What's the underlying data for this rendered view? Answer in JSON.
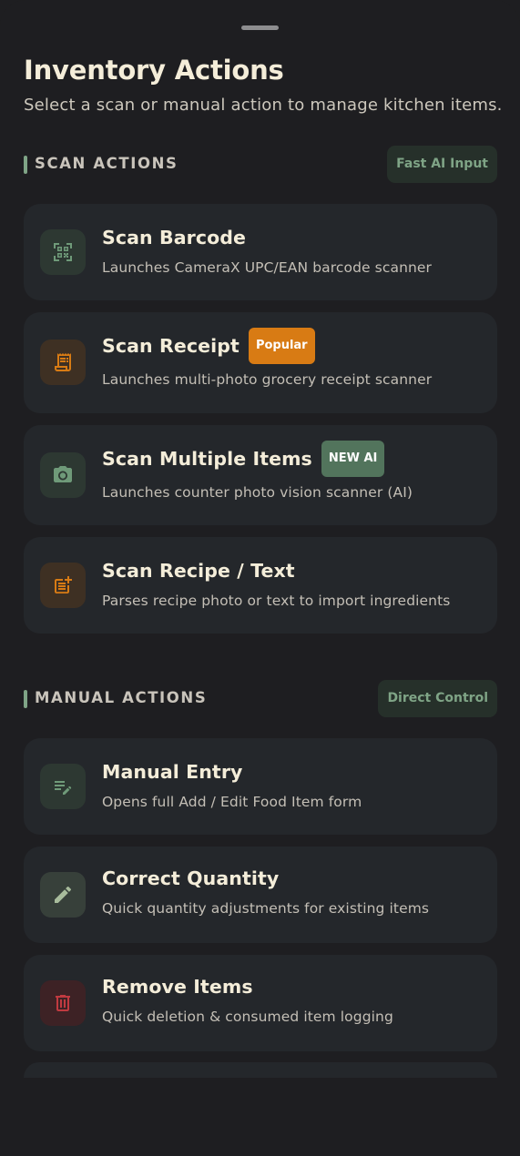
{
  "sheet": {
    "title": "Inventory Actions",
    "subtitle": "Select a scan or manual action to manage kitchen items."
  },
  "sections": {
    "scan": {
      "title": "SCAN ACTIONS",
      "chip": "Fast AI Input"
    },
    "manual": {
      "title": "MANUAL ACTIONS",
      "chip": "Direct Control"
    }
  },
  "scan_actions": [
    {
      "title": "Scan Barcode",
      "description": "Launches CameraX UPC/EAN barcode scanner",
      "icon": "qr-code-scanner-icon",
      "badge": ""
    },
    {
      "title": "Scan Receipt",
      "description": "Launches multi-photo grocery receipt scanner",
      "icon": "receipt-icon",
      "badge": "Popular"
    },
    {
      "title": "Scan Multiple Items",
      "description": "Launches counter photo vision scanner (AI)",
      "icon": "camera-icon",
      "badge": "NEW AI"
    },
    {
      "title": "Scan Recipe / Text",
      "description": "Parses recipe photo or text to import ingredients",
      "icon": "post-add-icon",
      "badge": ""
    }
  ],
  "manual_actions": [
    {
      "title": "Manual Entry",
      "description": "Opens full Add / Edit Food Item form",
      "icon": "edit-note-icon"
    },
    {
      "title": "Correct Quantity",
      "description": "Quick quantity adjustments for existing items",
      "icon": "pencil-icon"
    },
    {
      "title": "Remove Items",
      "description": "Quick deletion & consumed item logging",
      "icon": "trash-icon"
    }
  ],
  "colors": {
    "background": "#1e1e21",
    "card": "#24272b",
    "title_text": "#f4edd9",
    "accent_green": "#7fa486",
    "accent_orange": "#d87b14",
    "danger_red": "#c03a40"
  }
}
